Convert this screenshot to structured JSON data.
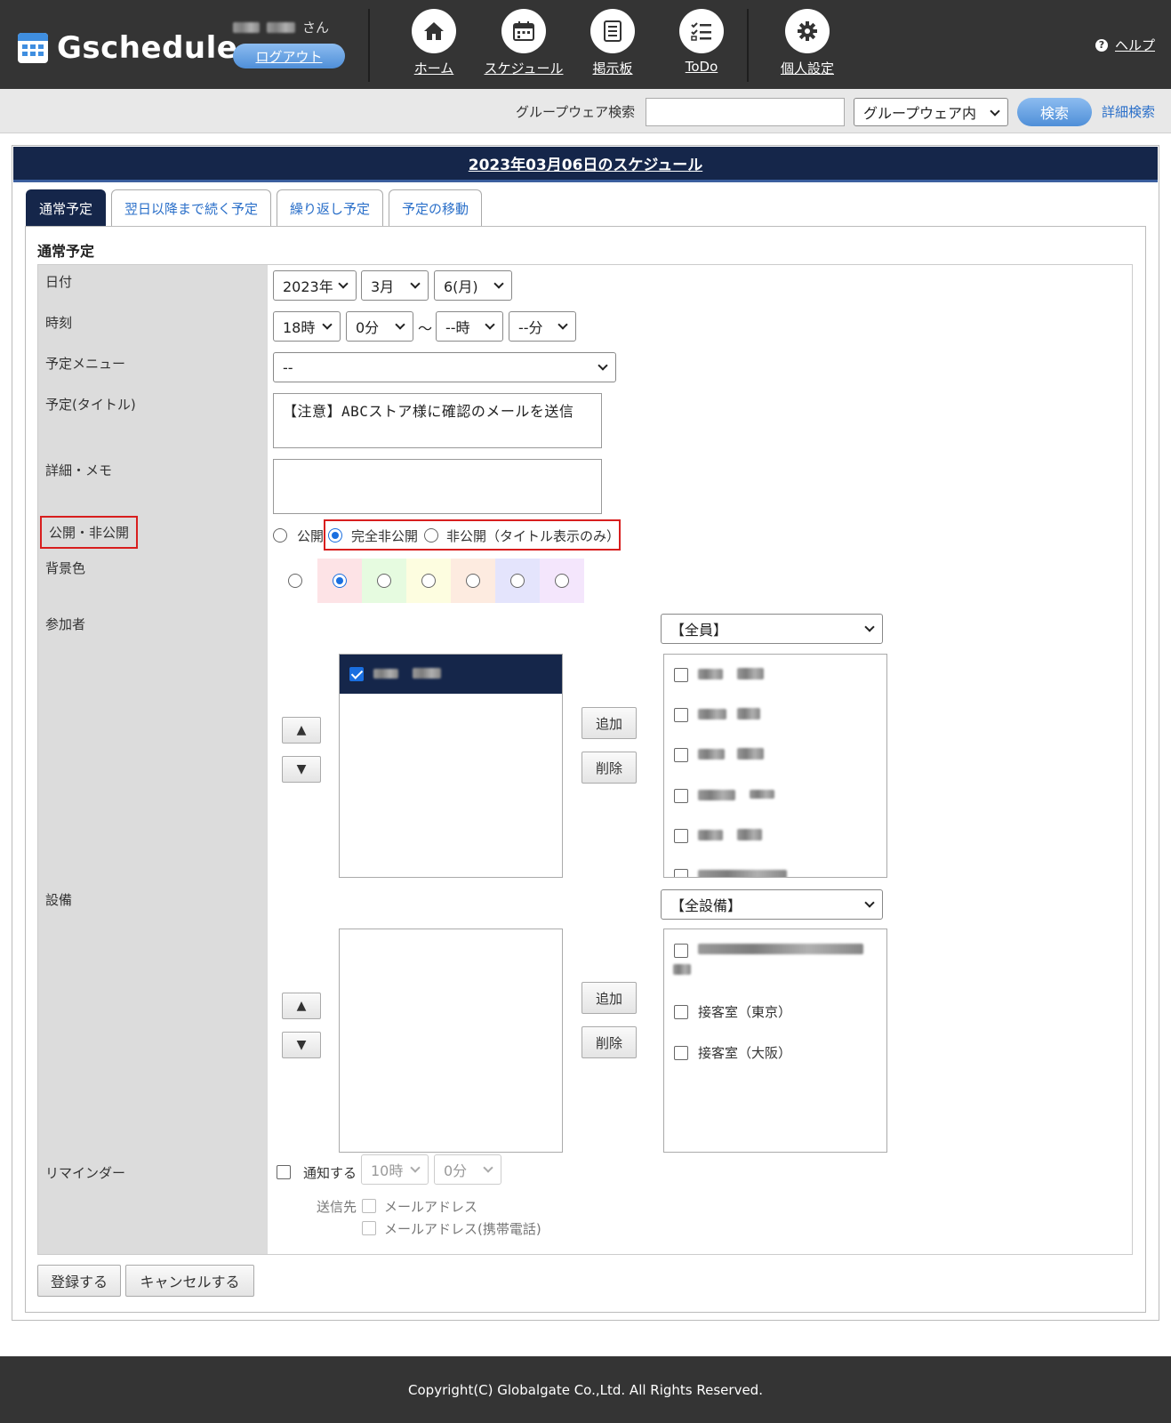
{
  "app": {
    "logo_text": "Gschedule",
    "user_suffix": "さん",
    "logout": "ログアウト",
    "help": "ヘルプ"
  },
  "nav": [
    {
      "label": "ホーム",
      "icon": "home-icon"
    },
    {
      "label": "スケジュール",
      "icon": "calendar-icon"
    },
    {
      "label": "掲示板",
      "icon": "bulletin-board-icon"
    },
    {
      "label": "ToDo",
      "icon": "todo-list-icon"
    },
    {
      "label": "個人設定",
      "icon": "gear-icon"
    }
  ],
  "search": {
    "label": "グループウェア検索",
    "input_value": "",
    "scope": "グループウェア内",
    "button": "検索",
    "advanced": "詳細検索"
  },
  "page_title": "2023年03月06日のスケジュール",
  "tabs": [
    "通常予定",
    "翌日以降まで続く予定",
    "繰り返し予定",
    "予定の移動"
  ],
  "active_tab": "通常予定",
  "section_title": "通常予定",
  "labels": {
    "date": "日付",
    "time": "時刻",
    "menu": "予定メニュー",
    "title": "予定(タイトル)",
    "memo": "詳細・メモ",
    "visibility": "公開・非公開",
    "bgcolor": "背景色",
    "participants": "参加者",
    "equipment": "設備",
    "reminder": "リマインダー"
  },
  "date": {
    "year": "2023年",
    "month": "3月",
    "day": "6(月)"
  },
  "time": {
    "start_hour": "18時",
    "start_min": "0分",
    "separator": "～",
    "end_hour": "--時",
    "end_min": "--分"
  },
  "menu_value": "--",
  "title_value": "【注意】ABCストア様に確認のメールを送信",
  "memo_value": "",
  "visibility": {
    "options": [
      "公開",
      "完全非公開",
      "非公開（タイトル表示のみ）"
    ],
    "selected": "完全非公開"
  },
  "bgcolors": [
    "#ffffff",
    "#fde3e6",
    "#e6fbe0",
    "#fdfde0",
    "#fdebe0",
    "#e4e4fc",
    "#f4e6fc"
  ],
  "bgcolor_selected_index": 1,
  "participants": {
    "group_select": "【全員】",
    "add": "追加",
    "remove": "削除",
    "up": "▲",
    "down": "▼"
  },
  "equipment": {
    "group_select": "【全設備】",
    "items": [
      "接客室（東京）",
      "接客室（大阪）"
    ],
    "add": "追加",
    "remove": "削除",
    "up": "▲",
    "down": "▼"
  },
  "reminder": {
    "notify": "通知する",
    "hour": "10時",
    "minute": "0分",
    "send_to": "送信先",
    "email": "メールアドレス",
    "mobile_email": "メールアドレス(携帯電話)"
  },
  "actions": {
    "register": "登録する",
    "cancel": "キャンセルする"
  },
  "footer": "Copyright(C) Globalgate Co.,Ltd. All Rights Reserved.",
  "colors": {
    "header_bg": "#343434",
    "title_bar": "#15264a",
    "accent_blue": "#4f8fd8",
    "highlight_red": "#d81e1e"
  }
}
